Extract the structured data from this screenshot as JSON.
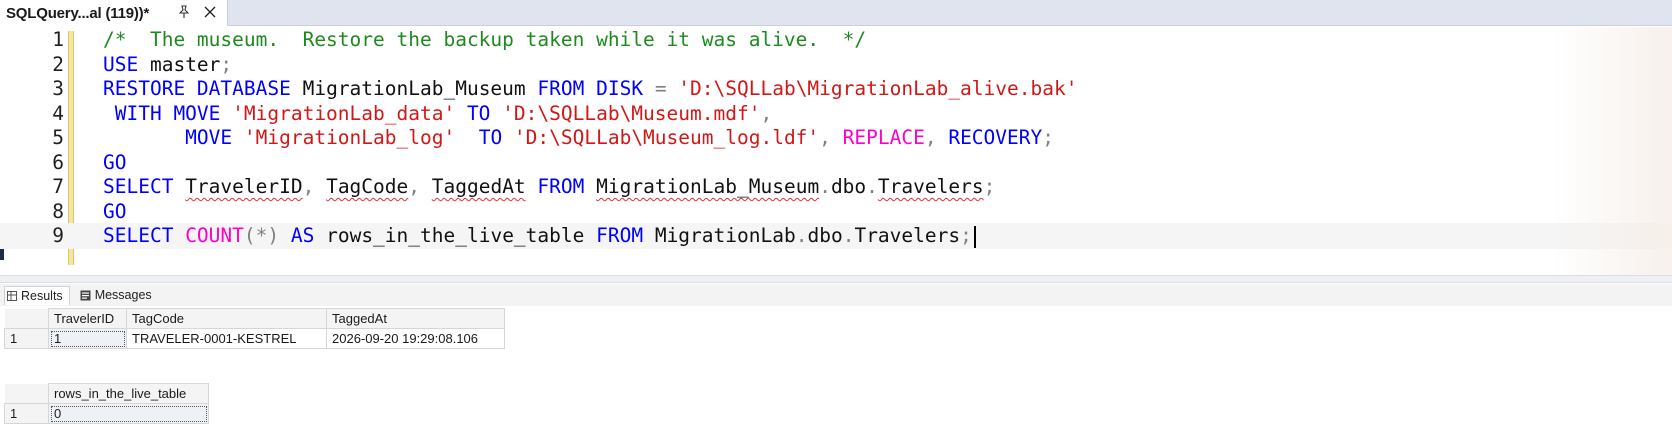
{
  "tab": {
    "title": "SQLQuery...al (119))*"
  },
  "editor": {
    "lines": [
      {
        "num": "1",
        "tokens": [
          {
            "t": "/*  The museum.  Restore the backup taken while it was alive.  */",
            "c": "cmt"
          }
        ]
      },
      {
        "num": "2",
        "tokens": [
          {
            "t": "USE ",
            "c": "kw"
          },
          {
            "t": "master",
            "c": ""
          },
          {
            "t": ";",
            "c": "op"
          }
        ]
      },
      {
        "num": "3",
        "tokens": [
          {
            "t": "RESTORE DATABASE ",
            "c": "kw"
          },
          {
            "t": "MigrationLab_Museum ",
            "c": ""
          },
          {
            "t": "FROM DISK ",
            "c": "kw"
          },
          {
            "t": "= ",
            "c": "op"
          },
          {
            "t": "'D:\\SQLLab\\MigrationLab_alive.bak'",
            "c": "str"
          }
        ]
      },
      {
        "num": "4",
        "tokens": [
          {
            "t": " WITH MOVE ",
            "c": "kw"
          },
          {
            "t": "'MigrationLab_data'",
            "c": "str"
          },
          {
            "t": " TO ",
            "c": "kw"
          },
          {
            "t": "'D:\\SQLLab\\Museum.mdf'",
            "c": "str"
          },
          {
            "t": ",",
            "c": "op"
          }
        ]
      },
      {
        "num": "5",
        "tokens": [
          {
            "t": "       MOVE ",
            "c": "kw"
          },
          {
            "t": "'MigrationLab_log'",
            "c": "str"
          },
          {
            "t": "  TO ",
            "c": "kw"
          },
          {
            "t": "'D:\\SQLLab\\Museum_log.ldf'",
            "c": "str"
          },
          {
            "t": ", ",
            "c": "op"
          },
          {
            "t": "REPLACE",
            "c": "fn"
          },
          {
            "t": ", ",
            "c": "op"
          },
          {
            "t": "RECOVERY",
            "c": "kw"
          },
          {
            "t": ";",
            "c": "op"
          }
        ]
      },
      {
        "num": "6",
        "tokens": [
          {
            "t": "GO",
            "c": "kw"
          }
        ]
      },
      {
        "num": "7",
        "tokens": [
          {
            "t": "SELECT ",
            "c": "kw"
          },
          {
            "t": "TravelerID",
            "c": "sq"
          },
          {
            "t": ", ",
            "c": "op"
          },
          {
            "t": "TagCode",
            "c": "sq"
          },
          {
            "t": ", ",
            "c": "op"
          },
          {
            "t": "TaggedAt",
            "c": "sq"
          },
          {
            "t": " FROM ",
            "c": "kw"
          },
          {
            "t": "MigrationLab_Museum",
            "c": "sq"
          },
          {
            "t": ".",
            "c": "op"
          },
          {
            "t": "dbo",
            "c": ""
          },
          {
            "t": ".",
            "c": "op"
          },
          {
            "t": "Travelers",
            "c": "sq"
          },
          {
            "t": ";",
            "c": "op"
          }
        ]
      },
      {
        "num": "8",
        "tokens": [
          {
            "t": "GO",
            "c": "kw"
          }
        ]
      },
      {
        "num": "9",
        "tokens": [
          {
            "t": "SELECT ",
            "c": "kw"
          },
          {
            "t": "COUNT",
            "c": "fn"
          },
          {
            "t": "(*)",
            "c": "op"
          },
          {
            "t": " AS ",
            "c": "kw"
          },
          {
            "t": "rows_in_the_live_table ",
            "c": ""
          },
          {
            "t": "FROM ",
            "c": "kw"
          },
          {
            "t": "MigrationLab",
            "c": ""
          },
          {
            "t": ".",
            "c": "op"
          },
          {
            "t": "dbo",
            "c": ""
          },
          {
            "t": ".",
            "c": "op"
          },
          {
            "t": "Travelers",
            "c": ""
          },
          {
            "t": ";",
            "c": "op"
          }
        ]
      }
    ]
  },
  "results_tabs": {
    "results": "Results",
    "messages": "Messages"
  },
  "grid1": {
    "columns": [
      "TravelerID",
      "TagCode",
      "TaggedAt"
    ],
    "rows": [
      {
        "num": "1",
        "cells": [
          "1",
          "TRAVELER-0001-KESTREL",
          "2026-09-20 19:29:08.106"
        ]
      }
    ]
  },
  "grid2": {
    "columns": [
      "rows_in_the_live_table"
    ],
    "rows": [
      {
        "num": "1",
        "cells": [
          "0"
        ]
      }
    ]
  }
}
